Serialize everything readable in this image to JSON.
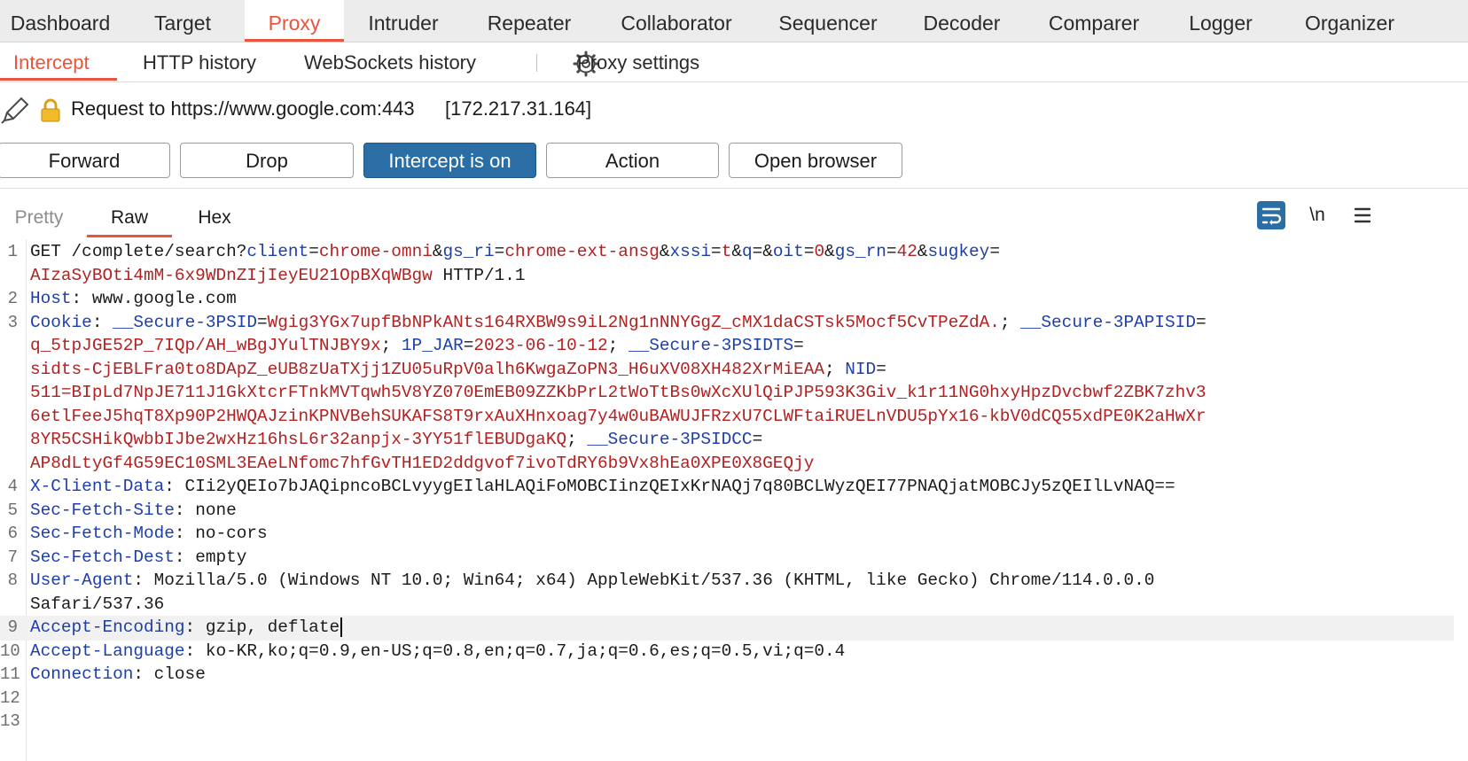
{
  "main_tabs": [
    {
      "label": "Dashboard"
    },
    {
      "label": "Target"
    },
    {
      "label": "Proxy"
    },
    {
      "label": "Intruder"
    },
    {
      "label": "Repeater"
    },
    {
      "label": "Collaborator"
    },
    {
      "label": "Sequencer"
    },
    {
      "label": "Decoder"
    },
    {
      "label": "Comparer"
    },
    {
      "label": "Logger"
    },
    {
      "label": "Organizer"
    }
  ],
  "active_main_tab": "Proxy",
  "sub_tabs": [
    {
      "label": "Intercept"
    },
    {
      "label": "HTTP history"
    },
    {
      "label": "WebSockets history"
    }
  ],
  "active_sub_tab": "Intercept",
  "proxy_settings_label": "Proxy settings",
  "request_info": {
    "text": "Request to https://www.google.com:443",
    "ip": "[172.217.31.164]"
  },
  "buttons": {
    "forward": "Forward",
    "drop": "Drop",
    "intercept": "Intercept is on",
    "action": "Action",
    "open_browser": "Open browser"
  },
  "view_tabs": [
    {
      "label": "Pretty"
    },
    {
      "label": "Raw"
    },
    {
      "label": "Hex"
    }
  ],
  "active_view_tab": "Raw",
  "newline_toggle_label": "\\n",
  "icons": {
    "edit": "pencil-icon",
    "lock": "lock-icon",
    "settings": "gear-icon",
    "wrap": "wrap-lines-icon",
    "menu": "hamburger-menu-icon"
  },
  "colors": {
    "accent": "#e8553c",
    "intercept_on": "#2b6ea6",
    "header_key": "#1e3fa8",
    "header_value": "#b22222"
  },
  "request_lines": [
    {
      "num": "1",
      "segments": [
        {
          "t": "GET /complete/search?",
          "c": ""
        },
        {
          "t": "client",
          "c": "hk"
        },
        {
          "t": "=",
          "c": ""
        },
        {
          "t": "chrome-omni",
          "c": "hv"
        },
        {
          "t": "&",
          "c": ""
        },
        {
          "t": "gs_ri",
          "c": "hk"
        },
        {
          "t": "=",
          "c": ""
        },
        {
          "t": "chrome-ext-ansg",
          "c": "hv"
        },
        {
          "t": "&",
          "c": ""
        },
        {
          "t": "xssi",
          "c": "hk"
        },
        {
          "t": "=",
          "c": ""
        },
        {
          "t": "t",
          "c": "hv"
        },
        {
          "t": "&",
          "c": ""
        },
        {
          "t": "q",
          "c": "hk"
        },
        {
          "t": "=&",
          "c": ""
        },
        {
          "t": "oit",
          "c": "hk"
        },
        {
          "t": "=",
          "c": ""
        },
        {
          "t": "0",
          "c": "hv"
        },
        {
          "t": "&",
          "c": ""
        },
        {
          "t": "gs_rn",
          "c": "hk"
        },
        {
          "t": "=",
          "c": ""
        },
        {
          "t": "42",
          "c": "hv"
        },
        {
          "t": "&",
          "c": ""
        },
        {
          "t": "sugkey",
          "c": "hk"
        },
        {
          "t": "=",
          "c": ""
        }
      ]
    },
    {
      "num": "",
      "segments": [
        {
          "t": "AIzaSyBOti4mM-6x9WDnZIjIeyEU21OpBXqWBgw",
          "c": "hv"
        },
        {
          "t": " HTTP/1.1",
          "c": ""
        }
      ]
    },
    {
      "num": "2",
      "segments": [
        {
          "t": "Host",
          "c": "hk"
        },
        {
          "t": ": www.google.com",
          "c": ""
        }
      ]
    },
    {
      "num": "3",
      "segments": [
        {
          "t": "Cookie",
          "c": "hk"
        },
        {
          "t": ": ",
          "c": ""
        },
        {
          "t": "__Secure-3PSID",
          "c": "hk"
        },
        {
          "t": "=",
          "c": ""
        },
        {
          "t": "Wgig3YGx7upfBbNPkANts164RXBW9s9iL2Ng1nNNYGgZ_cMX1daCSTsk5Mocf5CvTPeZdA.",
          "c": "hv"
        },
        {
          "t": "; ",
          "c": ""
        },
        {
          "t": "__Secure-3PAPISID",
          "c": "hk"
        },
        {
          "t": "=",
          "c": ""
        }
      ]
    },
    {
      "num": "",
      "segments": [
        {
          "t": "q_5tpJGE52P_7IQp/AH_wBgJYulTNJBY9x",
          "c": "hv"
        },
        {
          "t": "; ",
          "c": ""
        },
        {
          "t": "1P_JAR",
          "c": "hk"
        },
        {
          "t": "=",
          "c": ""
        },
        {
          "t": "2023-06-10-12",
          "c": "hv"
        },
        {
          "t": "; ",
          "c": ""
        },
        {
          "t": "__Secure-3PSIDTS",
          "c": "hk"
        },
        {
          "t": "=",
          "c": ""
        }
      ]
    },
    {
      "num": "",
      "segments": [
        {
          "t": "sidts-CjEBLFra0to8DApZ_eUB8zUaTXjj1ZU05uRpV0alh6KwgaZoPN3_H6uXV08XH482XrMiEAA",
          "c": "hv"
        },
        {
          "t": "; ",
          "c": ""
        },
        {
          "t": "NID",
          "c": "hk"
        },
        {
          "t": "=",
          "c": ""
        }
      ]
    },
    {
      "num": "",
      "segments": [
        {
          "t": "511=BIpLd7NpJE711J1GkXtcrFTnkMVTqwh5V8YZ070EmEB09ZZKbPrL2tWoTtBs0wXcXUlQiPJP593K3Giv_k1r11NG0hxyHpzDvcbwf2ZBK7zhv3",
          "c": "hv"
        }
      ]
    },
    {
      "num": "",
      "segments": [
        {
          "t": "6etlFeeJ5hqT8Xp90P2HWQAJzinKPNVBehSUKAFS8T9rxAuXHnxoag7y4w0uBAWUJFRzxU7CLWFtaiRUELnVDU5pYx16-kbV0dCQ55xdPE0K2aHwXr",
          "c": "hv"
        }
      ]
    },
    {
      "num": "",
      "segments": [
        {
          "t": "8YR5CSHikQwbbIJbe2wxHz16hsL6r32anpjx-3YY51flEBUDgaKQ",
          "c": "hv"
        },
        {
          "t": "; ",
          "c": ""
        },
        {
          "t": "__Secure-3PSIDCC",
          "c": "hk"
        },
        {
          "t": "=",
          "c": ""
        }
      ]
    },
    {
      "num": "",
      "segments": [
        {
          "t": "AP8dLtyGf4G59EC10SML3EAeLNfomc7hfGvTH1ED2ddgvof7ivoTdRY6b9Vx8hEa0XPE0X8GEQjy",
          "c": "hv"
        }
      ]
    },
    {
      "num": "4",
      "segments": [
        {
          "t": "X-Client-Data",
          "c": "hk"
        },
        {
          "t": ": CIi2yQEIo7bJAQipncoBCLvyygEIlaHLAQiFoMOBCIinzQEIxKrNAQj7q80BCLWyzQEI77PNAQjatMOBCJy5zQEIlLvNAQ==",
          "c": ""
        }
      ]
    },
    {
      "num": "5",
      "segments": [
        {
          "t": "Sec-Fetch-Site",
          "c": "hk"
        },
        {
          "t": ": none",
          "c": ""
        }
      ]
    },
    {
      "num": "6",
      "segments": [
        {
          "t": "Sec-Fetch-Mode",
          "c": "hk"
        },
        {
          "t": ": no-cors",
          "c": ""
        }
      ]
    },
    {
      "num": "7",
      "segments": [
        {
          "t": "Sec-Fetch-Dest",
          "c": "hk"
        },
        {
          "t": ": empty",
          "c": ""
        }
      ]
    },
    {
      "num": "8",
      "segments": [
        {
          "t": "User-Agent",
          "c": "hk"
        },
        {
          "t": ": Mozilla/5.0 (Windows NT 10.0; Win64; x64) AppleWebKit/537.36 (KHTML, like Gecko) Chrome/114.0.0.0",
          "c": ""
        }
      ]
    },
    {
      "num": "",
      "segments": [
        {
          "t": "Safari/537.36",
          "c": ""
        }
      ]
    },
    {
      "num": "9",
      "current": true,
      "segments": [
        {
          "t": "Accept-Encoding",
          "c": "hk"
        },
        {
          "t": ": gzip, deflate",
          "c": ""
        }
      ]
    },
    {
      "num": "10",
      "segments": [
        {
          "t": "Accept-Language",
          "c": "hk"
        },
        {
          "t": ": ko-KR,ko;q=0.9,en-US;q=0.8,en;q=0.7,ja;q=0.6,es;q=0.5,vi;q=0.4",
          "c": ""
        }
      ]
    },
    {
      "num": "11",
      "segments": [
        {
          "t": "Connection",
          "c": "hk"
        },
        {
          "t": ": close",
          "c": ""
        }
      ]
    },
    {
      "num": "12",
      "segments": []
    },
    {
      "num": "13",
      "segments": []
    }
  ]
}
